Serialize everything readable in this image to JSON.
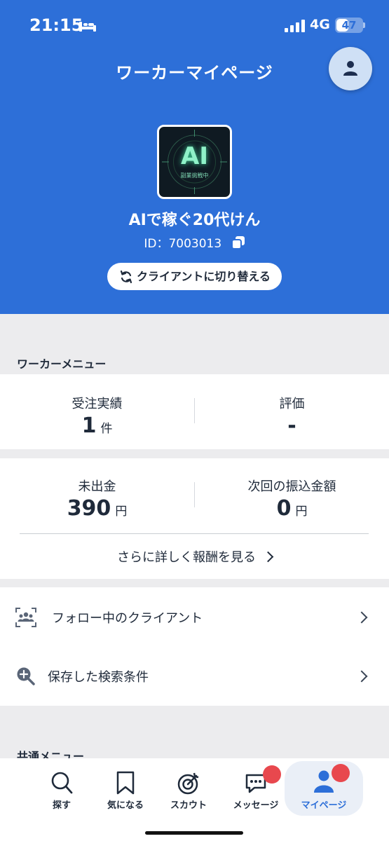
{
  "status_bar": {
    "time": "21:15",
    "network": "4G",
    "battery": "47",
    "battery_level": 0.47
  },
  "header": {
    "title": "ワーカーマイページ",
    "avatar_text": "AI",
    "avatar_subtext": "副業挑戦中",
    "user_name": "AIで稼ぐ20代けん",
    "user_id": "ID：7003013",
    "switch_label": "クライアントに切り替える"
  },
  "worker_menu": {
    "title": "ワーカーメニュー",
    "orders_label": "受注実績",
    "orders_value": "1",
    "orders_unit": "件",
    "rating_label": "評価",
    "rating_value": "-",
    "unpaid_label": "未出金",
    "unpaid_value": "390",
    "unpaid_unit": "円",
    "next_transfer_label": "次回の振込金額",
    "next_transfer_value": "0",
    "next_transfer_unit": "円",
    "more_link": "さらに詳しく報酬を見る"
  },
  "menu": {
    "follow_label": "フォロー中のクライアント",
    "saved_search_label": "保存した検索条件"
  },
  "common_menu": {
    "title": "共通メニュー"
  },
  "nav": {
    "search": "探す",
    "favorites": "気になる",
    "scout": "スカウト",
    "messages": "メッセージ",
    "mypage": "マイページ"
  },
  "colors": {
    "brand": "#2d6fd8",
    "badge": "#e8484e"
  }
}
